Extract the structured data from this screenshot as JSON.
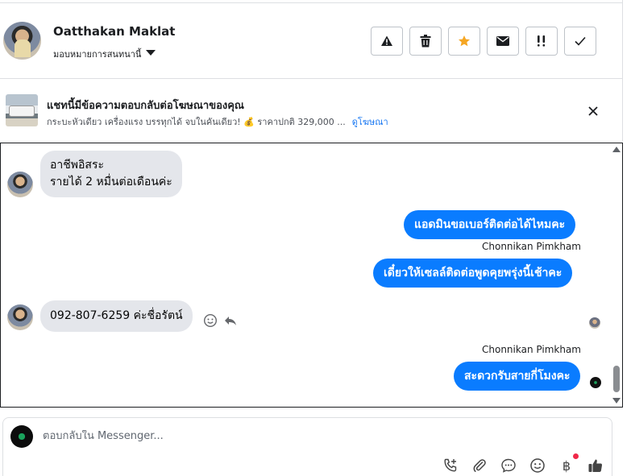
{
  "header": {
    "contact_name": "Oatthakan Maklat",
    "assign_label": "มอบหมายการสนทนานี้"
  },
  "toolbar": [
    {
      "icon": "warning-icon"
    },
    {
      "icon": "trash-icon"
    },
    {
      "icon": "star-icon",
      "color": "#f5a623"
    },
    {
      "icon": "envelope-icon"
    },
    {
      "icon": "follow-up-icon"
    },
    {
      "icon": "check-icon"
    }
  ],
  "ad": {
    "title": "แชทนี้มีข้อความตอบกลับต่อโฆษณาของคุณ",
    "subtitle": "กระบะหัวเดียว เครื่องแรง บรรทุกได้ จบในคันเดียว! 💰 ราคาปกติ 329,000 ...",
    "link": "ดูโฆษณา"
  },
  "messages": {
    "m1": {
      "from": "customer",
      "text_line1": "อาชีพอิสระ",
      "text_line2": "รายได้ 2 หมื่นต่อเดือนค่ะ"
    },
    "m2": {
      "from": "page",
      "text": "แอดมินขอเบอร์ติดต่อได้ไหมคะ"
    },
    "m3_sender": "Chonnikan Pimkham",
    "m3": {
      "from": "page",
      "text": "เดี๋ยวให้เซลล์ติดต่อพูดคุยพรุ่งนี้เช้าคะ"
    },
    "m4": {
      "from": "customer",
      "text": "092-807-6259 ค่ะชื่อรัตน์"
    },
    "m5_sender": "Chonnikan Pimkham",
    "m5": {
      "from": "page",
      "text": "สะดวกรับสายกี่โมงคะ"
    }
  },
  "composer": {
    "placeholder": "ตอบกลับใน Messenger...",
    "currency_symbol": "฿"
  },
  "colors": {
    "accent": "#0a7cff",
    "incoming_bubble": "#e4e6eb",
    "star": "#f5a623",
    "notification_dot": "#f02849"
  }
}
